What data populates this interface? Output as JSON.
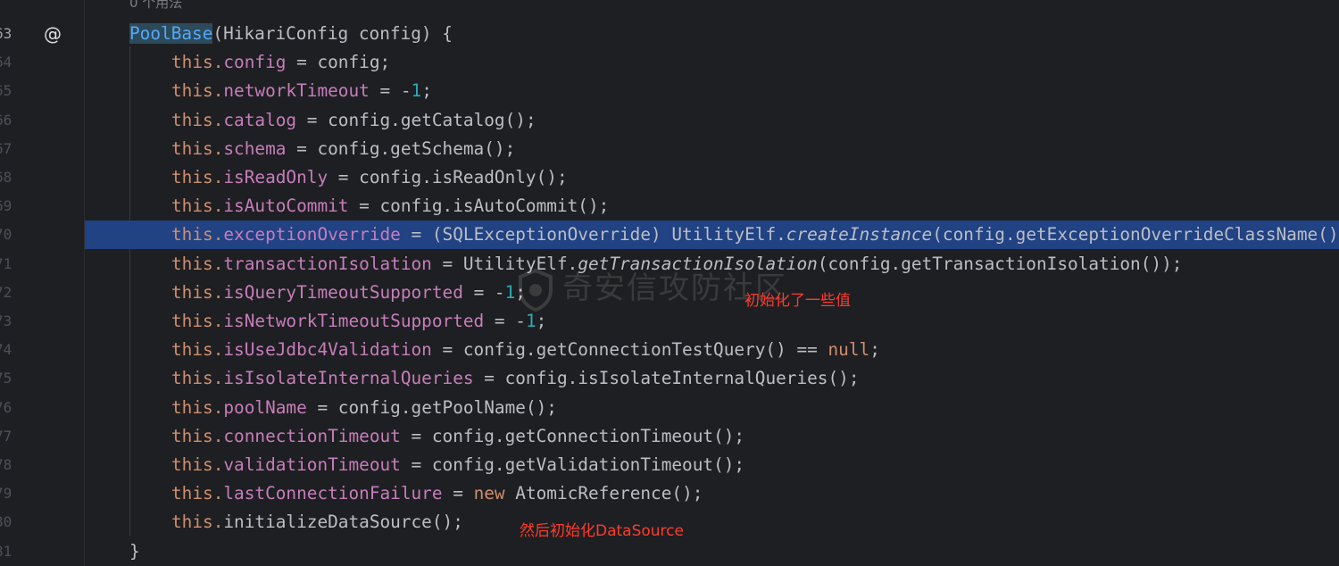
{
  "usage_hint": "0 个用法",
  "watermark_text": "奇安信攻防社区",
  "annotations": {
    "init_values": "初始化了一些值",
    "init_datasource": "然后初始化DataSource"
  },
  "gutter_icon": "at-sign-icon",
  "lines": [
    {
      "n": "63",
      "parts": [
        [
          "PoolBase",
          "decl"
        ],
        [
          "(HikariConfig config) {",
          ""
        ]
      ]
    },
    {
      "n": "64",
      "parts": [
        [
          "this.",
          "kw"
        ],
        [
          "config",
          "field"
        ],
        [
          " = config;",
          ""
        ]
      ]
    },
    {
      "n": "65",
      "parts": [
        [
          "this.",
          "kw"
        ],
        [
          "networkTimeout",
          "field"
        ],
        [
          " = -",
          ""
        ],
        [
          "1",
          "num"
        ],
        [
          ";",
          ""
        ]
      ]
    },
    {
      "n": "66",
      "parts": [
        [
          "this.",
          "kw"
        ],
        [
          "catalog",
          "field"
        ],
        [
          " = config.getCatalog();",
          ""
        ]
      ]
    },
    {
      "n": "67",
      "parts": [
        [
          "this.",
          "kw"
        ],
        [
          "schema",
          "field"
        ],
        [
          " = config.getSchema();",
          ""
        ]
      ]
    },
    {
      "n": "68",
      "parts": [
        [
          "this.",
          "kw"
        ],
        [
          "isReadOnly",
          "field"
        ],
        [
          " = config.isReadOnly();",
          ""
        ]
      ]
    },
    {
      "n": "69",
      "parts": [
        [
          "this.",
          "kw"
        ],
        [
          "isAutoCommit",
          "field"
        ],
        [
          " = config.isAutoCommit();",
          ""
        ]
      ]
    },
    {
      "n": "70",
      "selected": true,
      "parts": [
        [
          "this.",
          "kw"
        ],
        [
          "exceptionOverride",
          "field"
        ],
        [
          " = (SQLExceptionOverride) UtilityElf.",
          ""
        ],
        [
          "createInstance",
          "italic"
        ],
        [
          "(config.getExceptionOverrideClassName()",
          ""
        ]
      ]
    },
    {
      "n": "71",
      "parts": [
        [
          "this.",
          "kw"
        ],
        [
          "transactionIsolation",
          "field"
        ],
        [
          " = UtilityElf.",
          ""
        ],
        [
          "getTransactionIsolation",
          "italic"
        ],
        [
          "(config.getTransactionIsolation());",
          ""
        ]
      ]
    },
    {
      "n": "72",
      "parts": [
        [
          "this.",
          "kw"
        ],
        [
          "isQueryTimeoutSupported",
          "field"
        ],
        [
          " = -",
          ""
        ],
        [
          "1",
          "num"
        ],
        [
          ";",
          ""
        ]
      ]
    },
    {
      "n": "73",
      "parts": [
        [
          "this.",
          "kw"
        ],
        [
          "isNetworkTimeoutSupported",
          "field"
        ],
        [
          " = -",
          ""
        ],
        [
          "1",
          "num"
        ],
        [
          ";",
          ""
        ]
      ]
    },
    {
      "n": "74",
      "parts": [
        [
          "this.",
          "kw"
        ],
        [
          "isUseJdbc4Validation",
          "field"
        ],
        [
          " = config.getConnectionTestQuery() == ",
          ""
        ],
        [
          "null",
          "kw"
        ],
        [
          ";",
          ""
        ]
      ]
    },
    {
      "n": "75",
      "parts": [
        [
          "this.",
          "kw"
        ],
        [
          "isIsolateInternalQueries",
          "field"
        ],
        [
          " = config.isIsolateInternalQueries();",
          ""
        ]
      ]
    },
    {
      "n": "76",
      "parts": [
        [
          "this.",
          "kw"
        ],
        [
          "poolName",
          "field"
        ],
        [
          " = config.getPoolName();",
          ""
        ]
      ]
    },
    {
      "n": "77",
      "parts": [
        [
          "this.",
          "kw"
        ],
        [
          "connectionTimeout",
          "field"
        ],
        [
          " = config.getConnectionTimeout();",
          ""
        ]
      ]
    },
    {
      "n": "78",
      "parts": [
        [
          "this.",
          "kw"
        ],
        [
          "validationTimeout",
          "field"
        ],
        [
          " = config.getValidationTimeout();",
          ""
        ]
      ]
    },
    {
      "n": "79",
      "parts": [
        [
          "this.",
          "kw"
        ],
        [
          "lastConnectionFailure",
          "field"
        ],
        [
          " = ",
          ""
        ],
        [
          "new",
          "kw"
        ],
        [
          " AtomicReference();",
          ""
        ]
      ]
    },
    {
      "n": "80",
      "parts": [
        [
          "this.",
          "kw"
        ],
        [
          "initializeDataSource();",
          ""
        ]
      ]
    },
    {
      "n": "81",
      "parts": [
        [
          "}",
          ""
        ]
      ]
    }
  ]
}
